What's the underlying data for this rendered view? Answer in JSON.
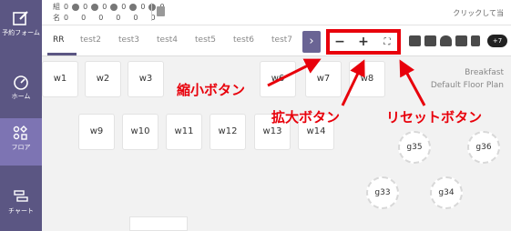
{
  "sidebar": {
    "items": [
      {
        "label": "予約フォーム"
      },
      {
        "label": "ホーム"
      },
      {
        "label": "フロア"
      },
      {
        "label": "チャート"
      }
    ]
  },
  "stats": {
    "row1": {
      "label": "組",
      "values": [
        "0",
        "0",
        "0",
        "0",
        "0",
        "0"
      ]
    },
    "row2": {
      "label": "名",
      "values": [
        "0",
        "0",
        "0",
        "0",
        "0",
        "0"
      ]
    },
    "copy_hint": "クリックして当"
  },
  "tabs": [
    "RR",
    "test2",
    "test3",
    "test4",
    "test5",
    "test6",
    "test7"
  ],
  "toolbar": {
    "scroll_label": "›",
    "zoom_out": "−",
    "zoom_in": "+",
    "reset": "⛶",
    "badge": "+7"
  },
  "floor": {
    "title_line1": "Breakfast",
    "title_line2": "Default Floor Plan",
    "tables": [
      "w1",
      "w2",
      "w3",
      "w6",
      "w7",
      "w8",
      "w9",
      "w10",
      "w11",
      "w12",
      "w13",
      "w14"
    ],
    "round_tables": [
      "g35",
      "g36",
      "g33",
      "g34"
    ]
  },
  "callouts": {
    "zoom_out": "縮小ボタン",
    "zoom_in": "拡大ボタン",
    "reset": "リセットボタン"
  },
  "colors": {
    "accent": "#e8000b",
    "sidebar": "#5b5683",
    "sidebar_active": "#7d74b3"
  }
}
